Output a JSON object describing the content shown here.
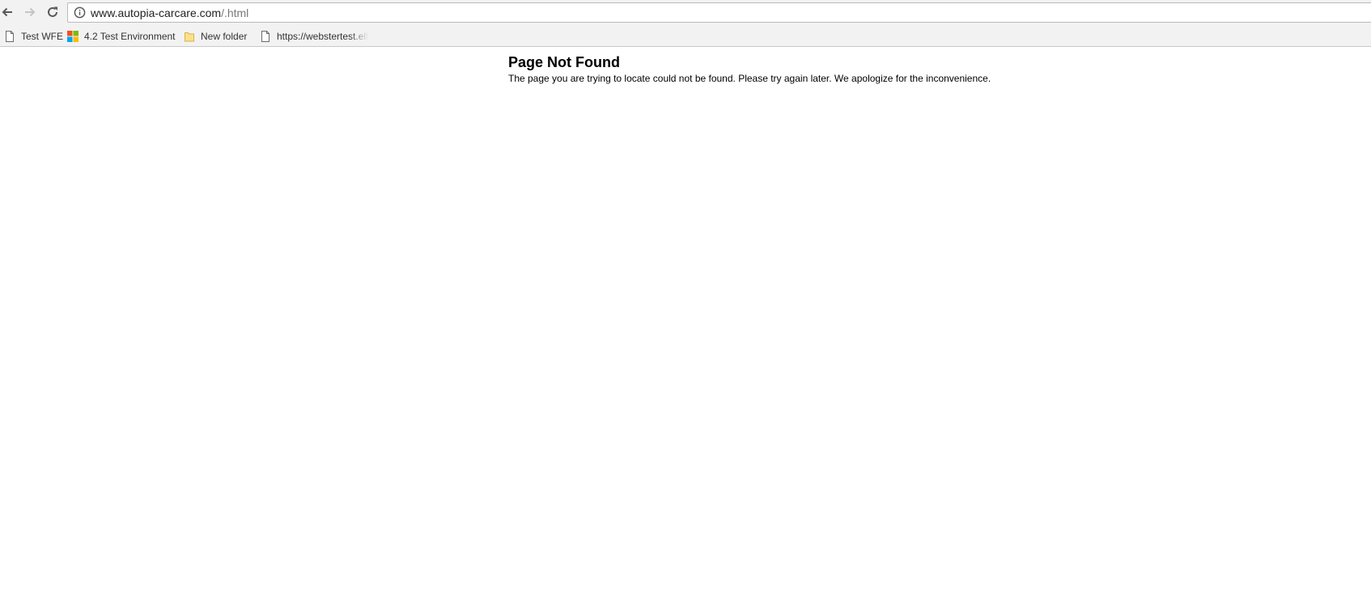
{
  "browser": {
    "address_bar": {
      "url_host": "www.autopia-carcare.com",
      "url_path": "/.html"
    },
    "icons": {
      "back": "back-arrow-icon",
      "forward": "forward-arrow-icon",
      "reload": "reload-icon",
      "site_info": "info-icon"
    },
    "bookmarks": [
      {
        "label": "Test WFE",
        "icon": "page-icon"
      },
      {
        "label": "4.2 Test Environment",
        "icon": "windows-logo-icon"
      },
      {
        "label": "New folder",
        "icon": "folder-icon"
      },
      {
        "label": "https://webstertest.ell",
        "icon": "page-icon"
      }
    ]
  },
  "page": {
    "title": "Page Not Found",
    "message": "The page you are trying to locate could not be found. Please try again later. We apologize for the inconvenience."
  }
}
